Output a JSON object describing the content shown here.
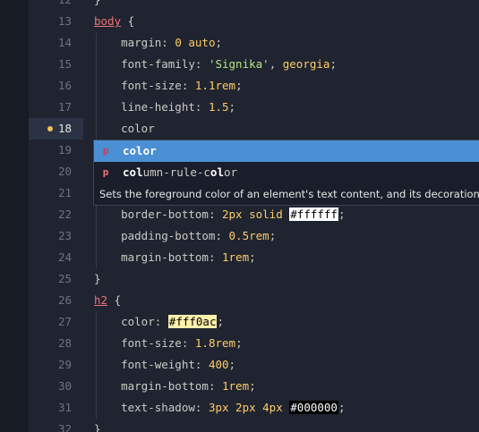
{
  "colors": {
    "background": "#1f2430",
    "selector": "#f07178",
    "value": "#ffcc66",
    "string": "#bae67e",
    "accent": "#4b8fd4"
  },
  "lines": [
    {
      "n": "12",
      "code": "}"
    },
    {
      "n": "13",
      "sel": "body",
      "rest": " {"
    },
    {
      "n": "14",
      "prop": "margin",
      "val": "0 auto"
    },
    {
      "n": "15",
      "prop": "font-family",
      "str": "'Signika'",
      "val2": "georgia"
    },
    {
      "n": "16",
      "prop": "font-size",
      "val": "1.1rem"
    },
    {
      "n": "17",
      "prop": "line-height",
      "val": "1.5"
    },
    {
      "n": "18",
      "typing": "color"
    },
    {
      "n": "19"
    },
    {
      "n": "20"
    },
    {
      "n": "21"
    },
    {
      "n": "22",
      "prop": "border-bottom",
      "val": "2px solid",
      "swatch": "#ffffff"
    },
    {
      "n": "23",
      "prop": "padding-bottom",
      "val": "0.5rem"
    },
    {
      "n": "24",
      "prop": "margin-bottom",
      "val": "1rem"
    },
    {
      "n": "25",
      "code": "}"
    },
    {
      "n": "26",
      "sel": "h2",
      "rest": " {"
    },
    {
      "n": "27",
      "prop": "color",
      "swatch": "#fff0ac"
    },
    {
      "n": "28",
      "prop": "font-size",
      "val": "1.8rem"
    },
    {
      "n": "29",
      "prop": "font-weight",
      "val": "400"
    },
    {
      "n": "30",
      "prop": "margin-bottom",
      "val": "1rem"
    },
    {
      "n": "31",
      "prop": "text-shadow",
      "val": "3px 2px 4px",
      "swatch": "#000000"
    },
    {
      "n": "32",
      "code": "}"
    }
  ],
  "autocomplete": {
    "items": [
      {
        "icon": "p",
        "label": "color"
      },
      {
        "icon": "p",
        "label": "column-rule-color"
      }
    ],
    "doc": "Sets the foreground color of an element's text content, and its decorations."
  }
}
